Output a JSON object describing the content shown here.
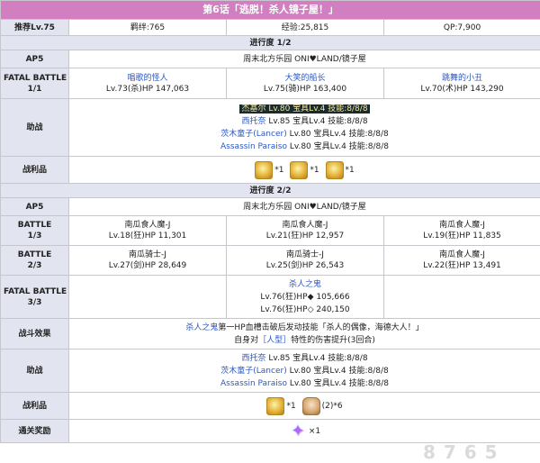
{
  "title": "第6话「逃脱！杀人镜子屋！」",
  "info": {
    "level": "推荐Lv.75",
    "bond": "羁绊:765",
    "exp": "经验:25,815",
    "qp": "QP:7,900"
  },
  "section1": {
    "header": "进行度 1/2",
    "ap_label": "AP5",
    "location": "周末北方乐园 ONI♥LAND/镜子屋",
    "battle_label_1": "FATAL BATTLE",
    "battle_label_2": "1/1",
    "enemies": [
      {
        "name": "唱歌的怪人",
        "stats": "Lv.73(杀)HP 147,063"
      },
      {
        "name": "大笑的船长",
        "stats": "Lv.75(骑)HP 163,400"
      },
      {
        "name": "跳舞的小丑",
        "stats": "Lv.70(术)HP 143,290"
      }
    ],
    "support_label": "助战",
    "support": [
      {
        "name": "杰基尔",
        "detail": " Lv.80 宝具Lv.4 技能:8/8/8"
      },
      {
        "name": "西托奈",
        "detail": " Lv.85 宝具Lv.4 技能:8/8/8"
      },
      {
        "name": "茨木童子(Lancer)",
        "detail": " Lv.80 宝具Lv.4 技能:8/8/8"
      },
      {
        "name": "Assassin Paraiso",
        "detail": " Lv.80 宝具Lv.4 技能:8/8/8"
      }
    ],
    "loot_label": "战利品",
    "loot": [
      "*1",
      "*1",
      "*1"
    ]
  },
  "section2": {
    "header": "进行度 2/2",
    "ap_label": "AP5",
    "location": "周末北方乐园 ONI♥LAND/镜子屋",
    "battles": [
      {
        "label1": "BATTLE",
        "label2": "1/3",
        "enemies": [
          {
            "name": "南瓜食人魔-J",
            "stats": "Lv.18(狂)HP 11,301"
          },
          {
            "name": "南瓜食人魔-J",
            "stats": "Lv.21(狂)HP 12,957"
          },
          {
            "name": "南瓜食人魔-J",
            "stats": "Lv.19(狂)HP 11,835"
          }
        ]
      },
      {
        "label1": "BATTLE",
        "label2": "2/3",
        "enemies": [
          {
            "name": "南瓜骑士-J",
            "stats": "Lv.27(剑)HP 28,649"
          },
          {
            "name": "南瓜骑士-J",
            "stats": "Lv.25(剑)HP 26,543"
          },
          {
            "name": "南瓜食人魔-J",
            "stats": "Lv.22(狂)HP 13,491"
          }
        ]
      }
    ],
    "fatal": {
      "label1": "FATAL BATTLE",
      "label2": "3/3",
      "name": "杀人之鬼",
      "stats1": "Lv.76(狂)HP◆ 105,666",
      "stats2": "Lv.76(狂)HP◇ 240,150"
    },
    "effect_label": "战斗效果",
    "effect": {
      "name": "杀人之鬼",
      "text1": "第一HP血槽击破后发动技能「杀人的偶像，海德大人！」",
      "text2_pre": "自身对",
      "trait": "［人型］",
      "text2_post": "特性的伤害提升(3回合)"
    },
    "support_label": "助战",
    "support": [
      {
        "name": "西托奈",
        "detail": " Lv.85 宝具Lv.4 技能:8/8/8"
      },
      {
        "name": "茨木童子(Lancer)",
        "detail": " Lv.80 宝具Lv.4 技能:8/8/8"
      },
      {
        "name": "Assassin Paraiso",
        "detail": " Lv.80 宝具Lv.4 技能:8/8/8"
      }
    ],
    "loot_label": "战利品",
    "loot": [
      "*1",
      "(2)*6"
    ],
    "reward_label": "通关奖励",
    "reward": "×1"
  },
  "watermark": "8 7 6 5",
  "icons": [
    "gold-figure-icon",
    "gold-figure-icon",
    "gold-figure-icon",
    "gold-figure-icon",
    "bottle-icon",
    "saint-quartz-icon"
  ]
}
